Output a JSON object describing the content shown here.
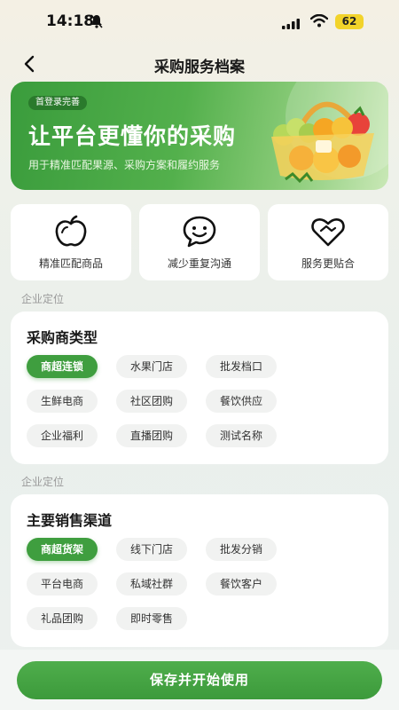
{
  "status_bar": {
    "time": "14:18",
    "battery": "62"
  },
  "header": {
    "title": "采购服务档案"
  },
  "banner": {
    "tag": "首登录完善",
    "title": "让平台更懂你的采购",
    "subtitle": "用于精准匹配果源、采购方案和履约服务"
  },
  "features": [
    {
      "label": "精准匹配商品",
      "icon": "apple-icon"
    },
    {
      "label": "减少重复沟通",
      "icon": "chat-smile-icon"
    },
    {
      "label": "服务更贴合",
      "icon": "handshake-heart-icon"
    }
  ],
  "sections": [
    {
      "caption": "企业定位",
      "title": "采购商类型",
      "options": [
        "商超连锁",
        "水果门店",
        "批发档口",
        "生鲜电商",
        "社区团购",
        "餐饮供应",
        "企业福利",
        "直播团购",
        "测试名称"
      ],
      "selected": "商超连锁"
    },
    {
      "caption": "企业定位",
      "title": "主要销售渠道",
      "options": [
        "商超货架",
        "线下门店",
        "批发分销",
        "平台电商",
        "私域社群",
        "餐饮客户",
        "礼品团购",
        "即时零售"
      ],
      "selected": "商超货架"
    }
  ],
  "footer": {
    "button_label": "保存并开始使用"
  },
  "colors": {
    "accent": "#3f9e3f",
    "battery": "#f2d32a"
  }
}
